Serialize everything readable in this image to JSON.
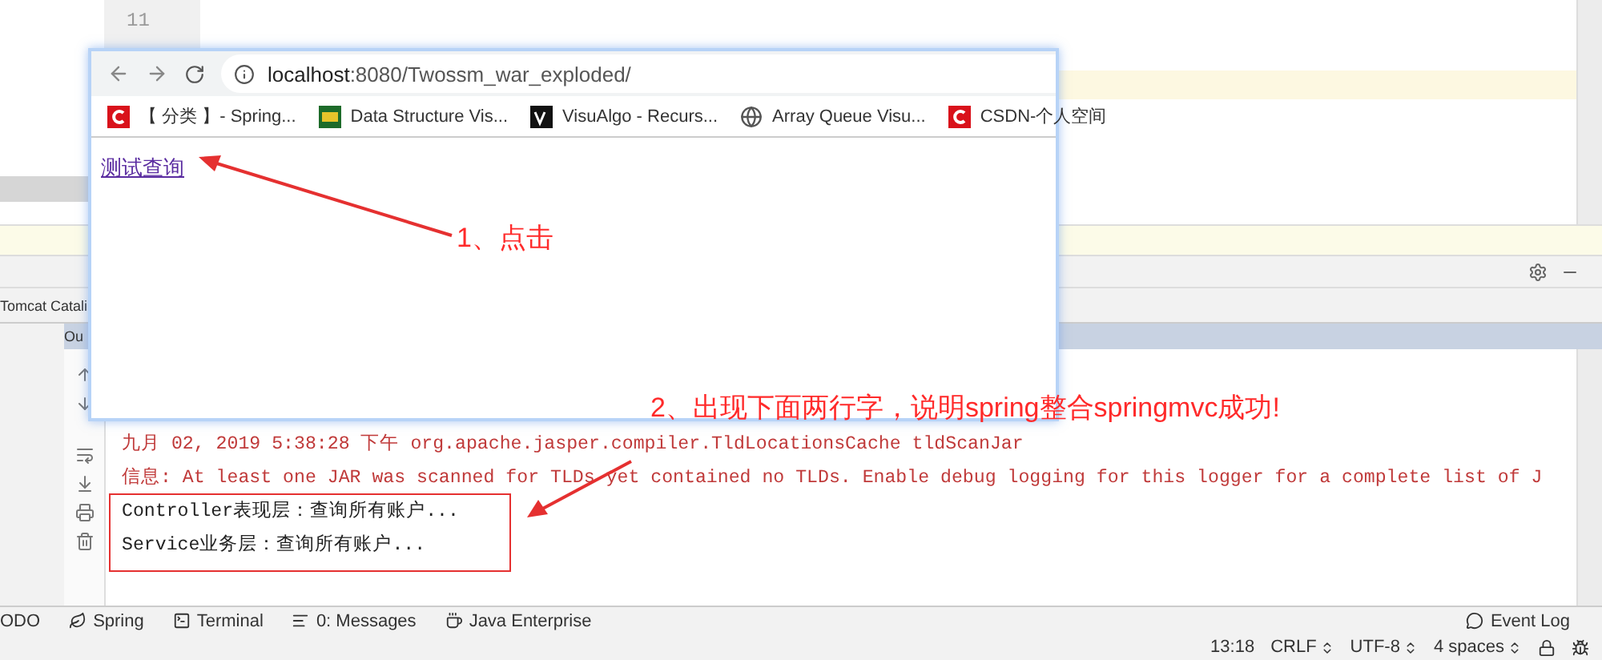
{
  "editor": {
    "line_numbers": [
      "11"
    ]
  },
  "tool_window": {
    "tab": "Tomcat Catali",
    "output_tab": "Ou"
  },
  "console": {
    "lines": [
      {
        "kind": "log",
        "text": "九月 02, 2019 5:38:28 下午 org.apache.jasper.compiler.TldLocationsCache tldScanJar"
      },
      {
        "kind": "log",
        "text": "信息: At least one JAR was scanned for TLDs yet contained no TLDs. Enable debug logging for this logger for a complete list of J"
      },
      {
        "kind": "out",
        "text": "Controller表现层：查询所有账户..."
      },
      {
        "kind": "out",
        "text": "Service业务层：查询所有账户..."
      }
    ]
  },
  "browser": {
    "address": {
      "host": "localhost",
      "path": ":8080/Twossm_war_exploded/"
    },
    "bookmarks": [
      {
        "kind": "csdn",
        "label": "【 分类 】- Spring..."
      },
      {
        "kind": "usf",
        "label": "Data Structure Vis..."
      },
      {
        "kind": "va",
        "label": "VisuAlgo - Recurs..."
      },
      {
        "kind": "globe",
        "label": "Array Queue Visu..."
      },
      {
        "kind": "csdn",
        "label": "CSDN-个人空间"
      }
    ],
    "link": "测试查询"
  },
  "annotations": [
    {
      "text": "1、点击"
    },
    {
      "text": "2、出现下面两行字，说明spring整合springmvc成功!"
    }
  ],
  "bottom_tabs": [
    {
      "kind": "plain",
      "label": "ODO"
    },
    {
      "kind": "spring",
      "label": "Spring"
    },
    {
      "kind": "terminal",
      "label": "Terminal"
    },
    {
      "kind": "messages",
      "label": "0: Messages"
    },
    {
      "kind": "javaee",
      "label": "Java Enterprise"
    }
  ],
  "event_log": "Event Log",
  "status": [
    {
      "kind": "plain",
      "label": "13:18"
    },
    {
      "kind": "select",
      "label": "CRLF"
    },
    {
      "kind": "select",
      "label": "UTF-8"
    },
    {
      "kind": "select",
      "label": "4 spaces"
    }
  ]
}
